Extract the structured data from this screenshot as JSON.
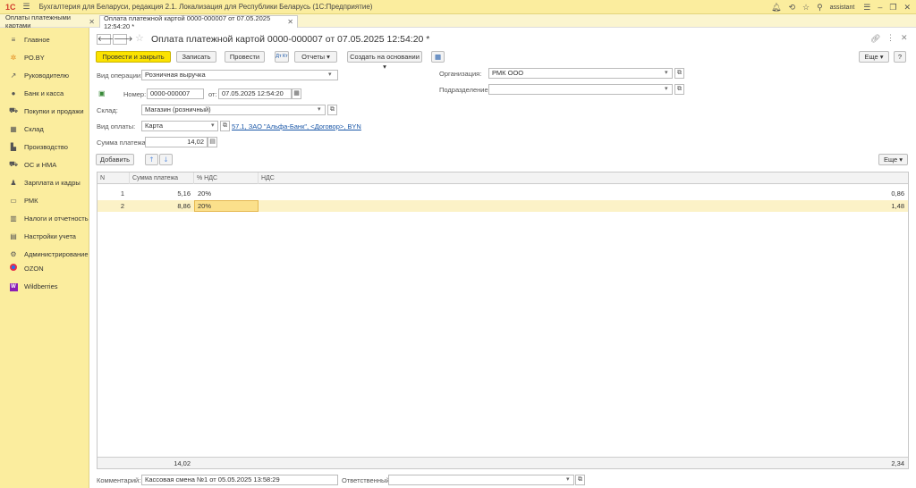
{
  "app": {
    "logo": "1С",
    "title": "Бухгалтерия для Беларуси, редакция 2.1. Локализация для Республики Беларусь",
    "subtitle": "(1С:Предприятие)",
    "user": "assistant"
  },
  "tabs": [
    {
      "label": "Оплаты платежными картами"
    },
    {
      "label": "Оплата платежной картой 0000-000007 от 07.05.2025 12:54:20 *"
    }
  ],
  "sidebar": {
    "items": [
      {
        "label": "Главное",
        "icon": "list-icon",
        "glyph": "≡"
      },
      {
        "label": "РО.BY",
        "icon": "ro-by-icon",
        "glyph": "✲"
      },
      {
        "label": "Руководителю",
        "icon": "chart-trend-icon",
        "glyph": "↗"
      },
      {
        "label": "Банк и касса",
        "icon": "bank-icon",
        "glyph": "●"
      },
      {
        "label": "Покупки и продажи",
        "icon": "cart-icon",
        "glyph": "⛟"
      },
      {
        "label": "Склад",
        "icon": "warehouse-icon",
        "glyph": "▦"
      },
      {
        "label": "Производство",
        "icon": "factory-icon",
        "glyph": "▙"
      },
      {
        "label": "ОС и НМА",
        "icon": "truck-icon",
        "glyph": "⛟"
      },
      {
        "label": "Зарплата и кадры",
        "icon": "person-icon",
        "glyph": "♟"
      },
      {
        "label": "РМК",
        "icon": "cash-register-icon",
        "glyph": "▭"
      },
      {
        "label": "Налоги и отчетность",
        "icon": "tax-report-icon",
        "glyph": "▥"
      },
      {
        "label": "Настройки учета",
        "icon": "accounting-settings-icon",
        "glyph": "▤"
      },
      {
        "label": "Администрирование",
        "icon": "gear-icon",
        "glyph": "⚙"
      },
      {
        "label": "OZON",
        "icon": "ozon-icon",
        "glyph": ""
      },
      {
        "label": "Wildberries",
        "icon": "wildberries-icon",
        "glyph": "W"
      }
    ]
  },
  "document": {
    "title": "Оплата платежной картой 0000-000007 от 07.05.2025 12:54:20 *"
  },
  "toolbar": {
    "post_close": "Провести и закрыть",
    "save": "Записать",
    "post": "Провести",
    "dt_kt": "Дт Кт",
    "reports": "Отчеты",
    "create_based": "Создать на основании",
    "more": "Еще",
    "help": "?"
  },
  "form": {
    "operation_label": "Вид операции:",
    "operation_value": "Розничная выручка",
    "number_label": "Номер:",
    "number_value": "0000-000007",
    "date_label": "от:",
    "date_value": "07.05.2025 12:54:20",
    "warehouse_label": "Склад:",
    "warehouse_value": "Магазин (розничный)",
    "payment_type_label": "Вид оплаты:",
    "payment_type_value": "Карта",
    "payment_link": "57.1, ЗАО \"Альфа-Банк\", <Договор>, BYN",
    "amount_label": "Сумма платежа:",
    "amount_value": "14,02",
    "org_label": "Организация:",
    "org_value": "РМК ООО",
    "division_label": "Подразделение:",
    "division_value": ""
  },
  "table_toolbar": {
    "add": "Добавить",
    "more": "Еще"
  },
  "table": {
    "headers": [
      "N",
      "Сумма платежа",
      "% НДС",
      "НДС"
    ],
    "rows": [
      {
        "n": "1",
        "amount": "5,16",
        "vat_rate": "20%",
        "vat": "0,86"
      },
      {
        "n": "2",
        "amount": "8,86",
        "vat_rate": "20%",
        "vat": "1,48"
      }
    ],
    "total_amount": "14,02",
    "total_vat": "2,34"
  },
  "footer": {
    "comment_label": "Комментарий:",
    "comment_value": "Кассовая смена №1 от 05.05.2025 13:58:29",
    "responsible_label": "Ответственный:",
    "responsible_value": ""
  }
}
